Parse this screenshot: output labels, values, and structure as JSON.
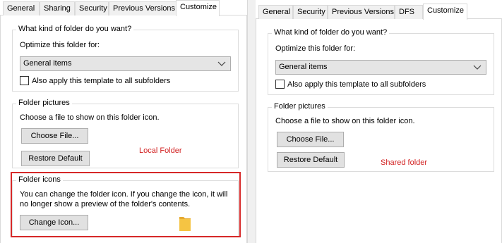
{
  "left": {
    "tabs": [
      "General",
      "Sharing",
      "Security",
      "Previous Versions",
      "Customize"
    ],
    "active_tab": "Customize",
    "group_type_label": "What kind of folder do you want?",
    "optimize_label": "Optimize this folder for:",
    "dropdown_value": "General items",
    "apply_label": "Also apply this template to all subfolders",
    "group_pictures_label": "Folder pictures",
    "pictures_text": "Choose a file to show on this folder icon.",
    "choose_file": "Choose File...",
    "restore_default": "Restore Default",
    "annotation": "Local Folder",
    "group_icons_label": "Folder icons",
    "icons_text_1": "You can change the folder icon. If you change the icon, it will",
    "icons_text_2": "no longer show a preview of the folder's contents.",
    "change_icon": "Change Icon..."
  },
  "right": {
    "tabs": [
      "General",
      "Security",
      "Previous Versions",
      "DFS",
      "Customize"
    ],
    "active_tab": "Customize",
    "group_type_label": "What kind of folder do you want?",
    "optimize_label": "Optimize this folder for:",
    "dropdown_value": "General items",
    "apply_label": "Also apply this template to all subfolders",
    "group_pictures_label": "Folder pictures",
    "pictures_text": "Choose a file to show on this folder icon.",
    "choose_file": "Choose File...",
    "restore_default": "Restore Default",
    "annotation": "Shared folder"
  },
  "colors": {
    "annotation": "#d22020",
    "highlight_border": "#d62828",
    "folder_icon": "#f5c443"
  },
  "icons": {
    "dropdown": "chevron-down-icon",
    "folder": "folder-icon"
  }
}
